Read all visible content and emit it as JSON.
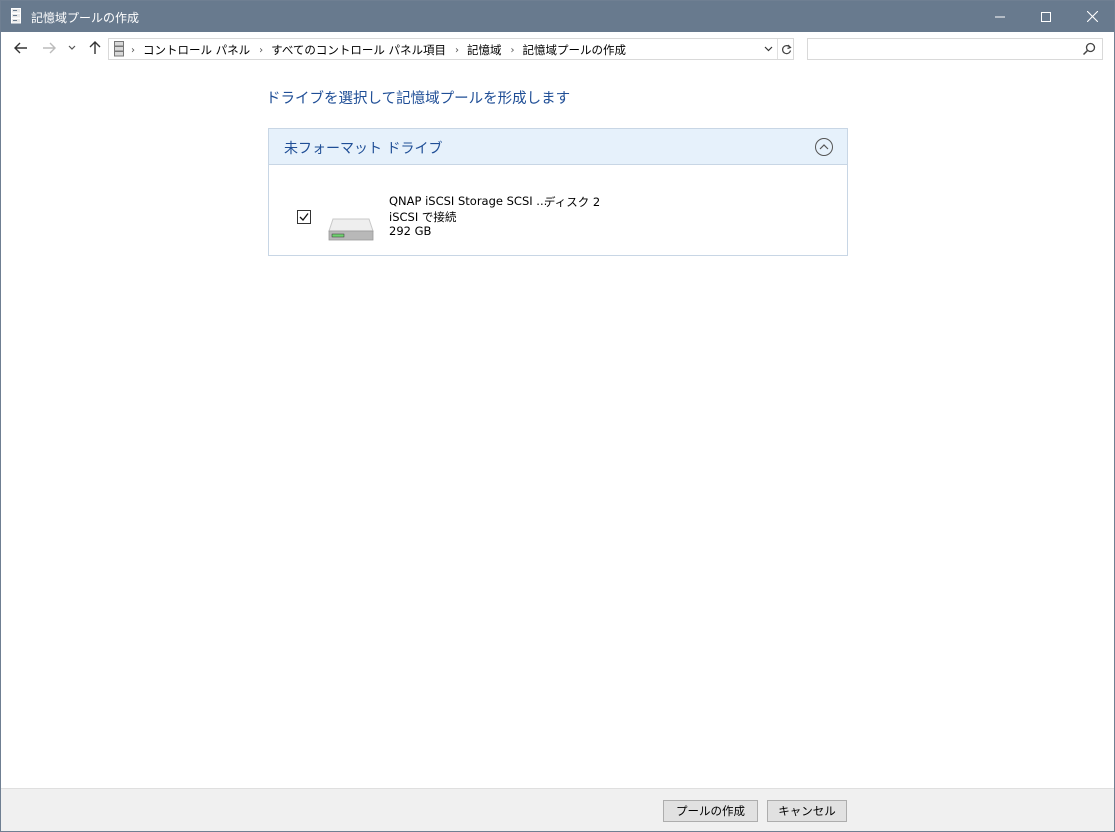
{
  "window": {
    "title": "記憶域プールの作成"
  },
  "nav": {
    "breadcrumbs": [
      "コントロール パネル",
      "すべてのコントロール パネル項目",
      "記憶域",
      "記憶域プールの作成"
    ],
    "search_placeholder": ""
  },
  "main": {
    "heading": "ドライブを選択して記憶域プールを形成します",
    "group": {
      "title": "未フォーマット ドライブ",
      "drives": [
        {
          "name": "QNAP iSCSI Storage SCSI ...",
          "disk": "ディスク 2",
          "connection": "iSCSI で接続",
          "size": "292 GB",
          "checked": true
        }
      ]
    }
  },
  "footer": {
    "create_label": "プールの作成",
    "cancel_label": "キャンセル"
  },
  "colors": {
    "titlebar": "#687a8e",
    "heading": "#1f4e96",
    "group_header": "#e6f1fb"
  }
}
